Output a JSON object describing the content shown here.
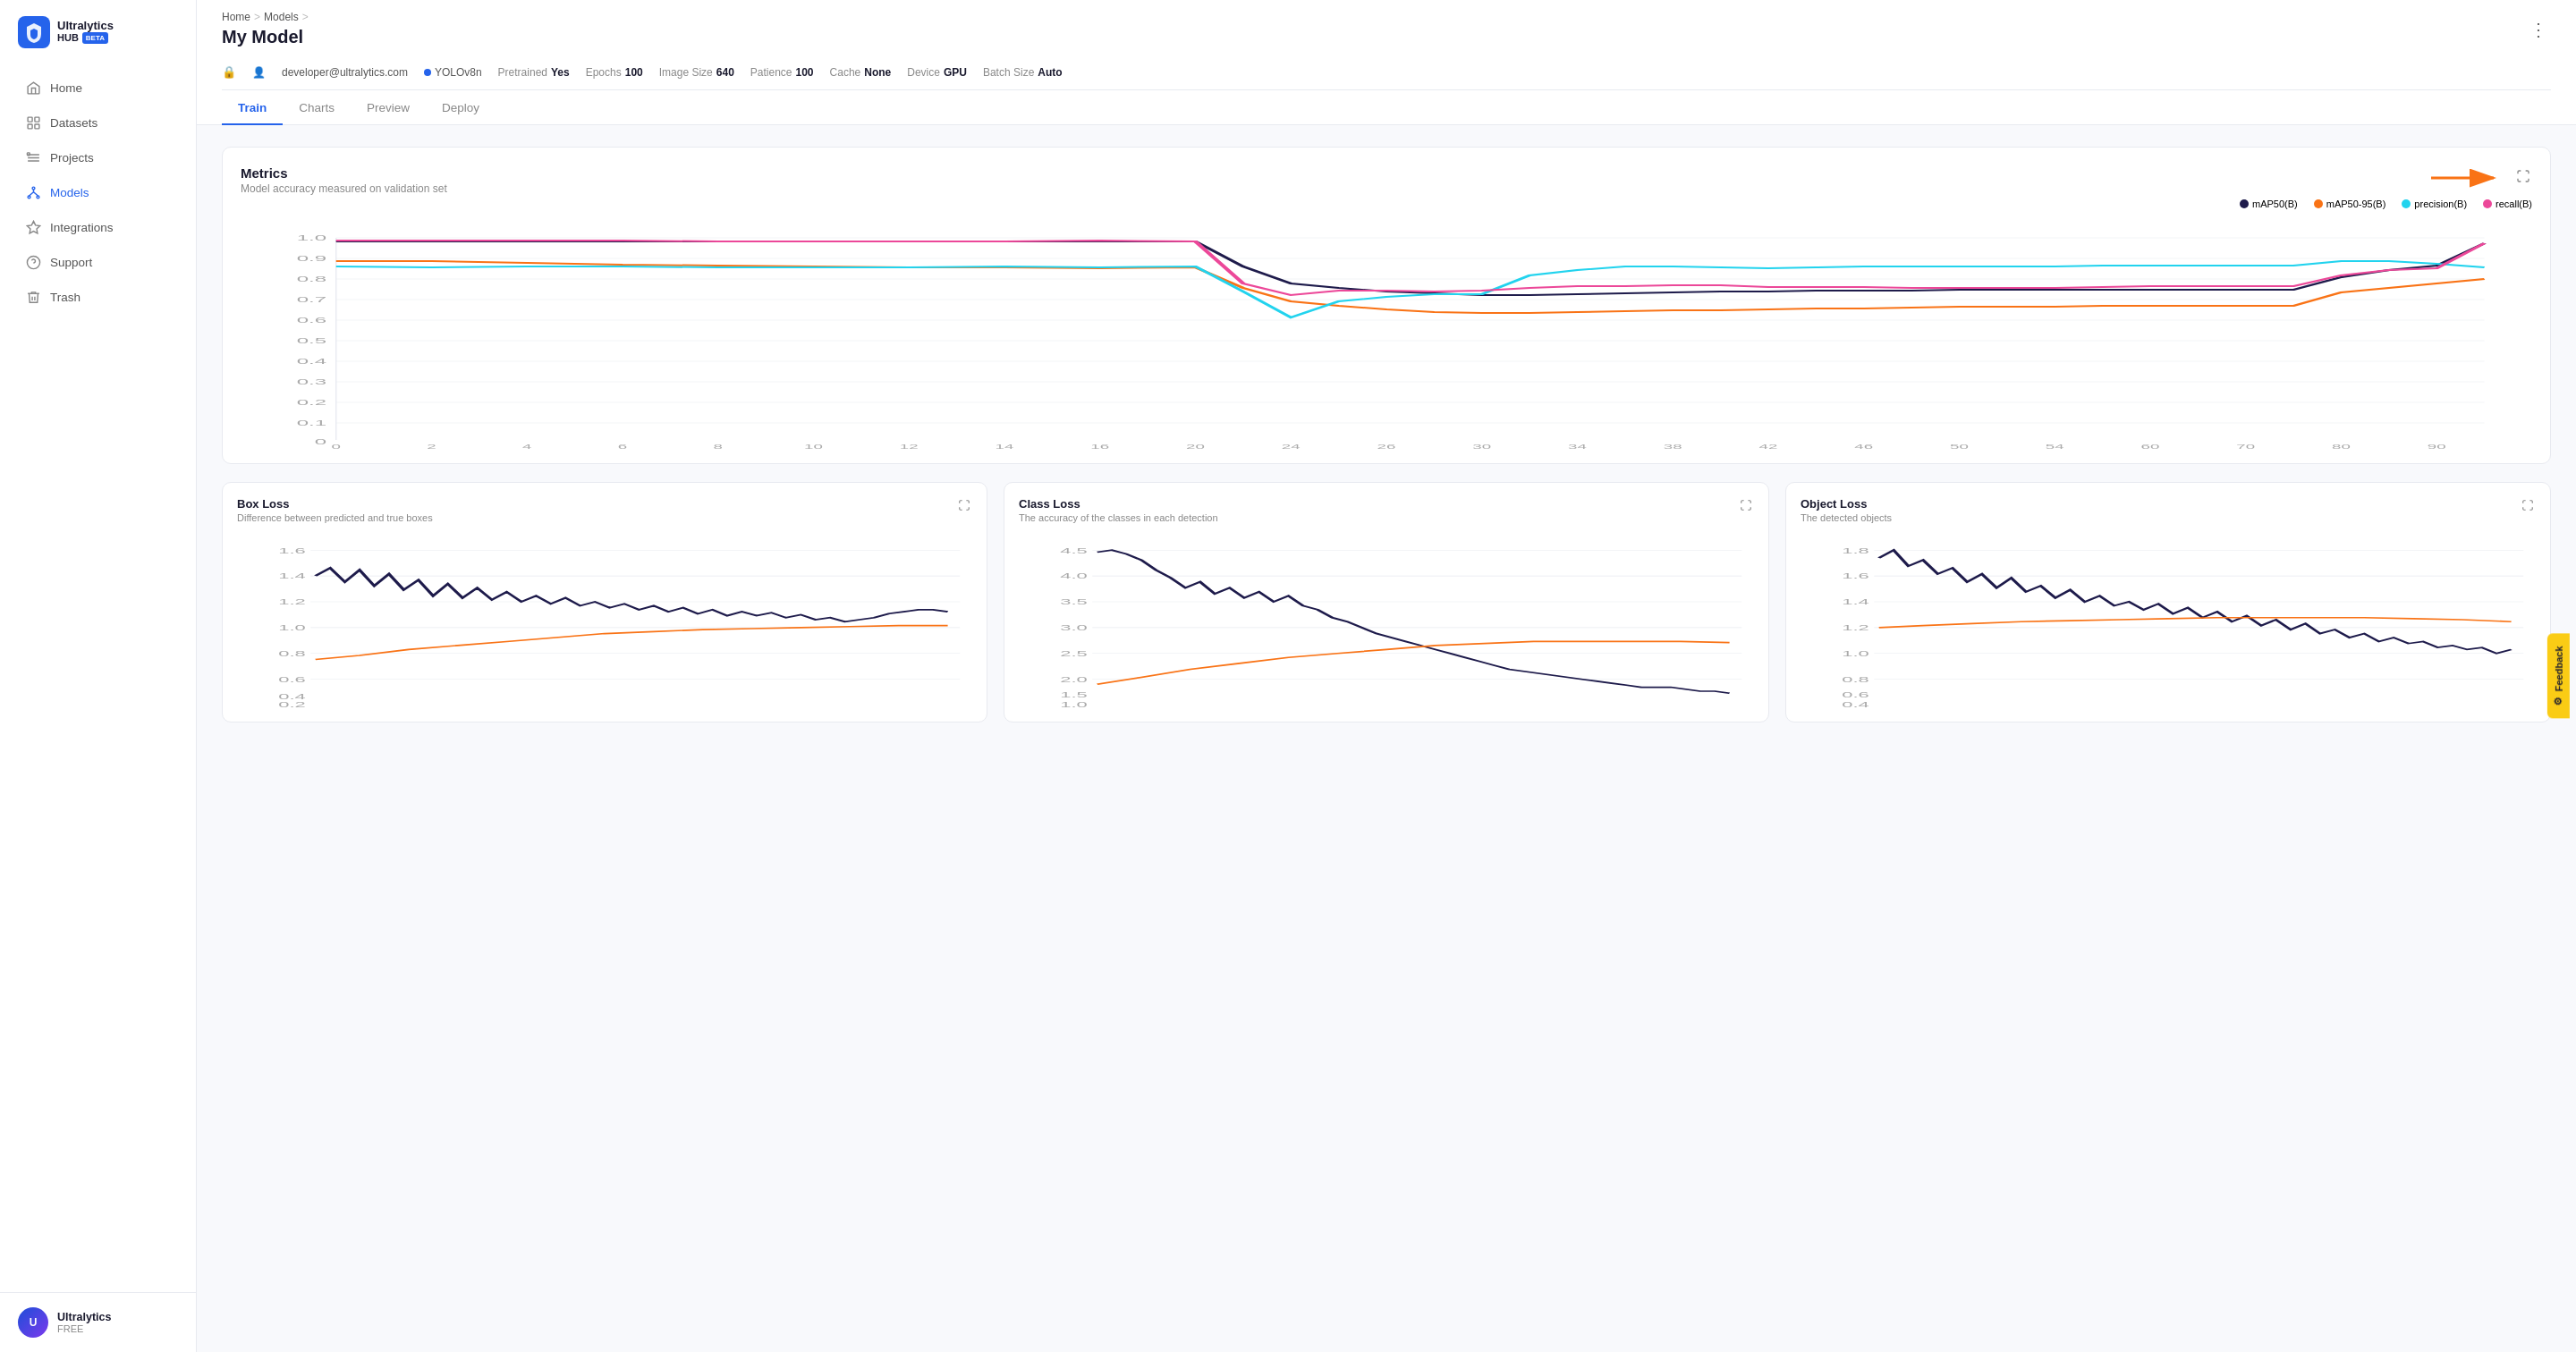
{
  "sidebar": {
    "logo": {
      "name": "Ultralytics",
      "hub": "HUB",
      "beta": "BETA"
    },
    "items": [
      {
        "id": "home",
        "label": "Home",
        "icon": "home"
      },
      {
        "id": "datasets",
        "label": "Datasets",
        "icon": "datasets"
      },
      {
        "id": "projects",
        "label": "Projects",
        "icon": "projects"
      },
      {
        "id": "models",
        "label": "Models",
        "icon": "models",
        "active": true
      },
      {
        "id": "integrations",
        "label": "Integrations",
        "icon": "integrations"
      },
      {
        "id": "support",
        "label": "Support",
        "icon": "support"
      },
      {
        "id": "trash",
        "label": "Trash",
        "icon": "trash"
      }
    ],
    "user": {
      "name": "Ultralytics",
      "plan": "FREE"
    }
  },
  "header": {
    "breadcrumb": [
      "Home",
      "Models"
    ],
    "title": "My Model",
    "model_info": {
      "email": "developer@ultralytics.com",
      "model": "YOLOv8n",
      "pretrained_label": "Pretrained",
      "pretrained_value": "Yes",
      "epochs_label": "Epochs",
      "epochs_value": "100",
      "image_size_label": "Image Size",
      "image_size_value": "640",
      "patience_label": "Patience",
      "patience_value": "100",
      "cache_label": "Cache",
      "cache_value": "None",
      "device_label": "Device",
      "device_value": "GPU",
      "batch_size_label": "Batch Size",
      "batch_size_value": "Auto"
    },
    "tabs": [
      {
        "id": "train",
        "label": "Train",
        "active": true
      },
      {
        "id": "charts",
        "label": "Charts",
        "active": false
      },
      {
        "id": "preview",
        "label": "Preview",
        "active": false
      },
      {
        "id": "deploy",
        "label": "Deploy",
        "active": false
      }
    ]
  },
  "metrics_chart": {
    "title": "Metrics",
    "subtitle": "Model accuracy measured on validation set",
    "legend": [
      {
        "label": "mAP50(B)",
        "color": "#1e1b4b"
      },
      {
        "label": "mAP50-95(B)",
        "color": "#f97316"
      },
      {
        "label": "precision(B)",
        "color": "#22d3ee"
      },
      {
        "label": "recall(B)",
        "color": "#ec4899"
      }
    ],
    "y_axis": [
      "1.0",
      "0.9",
      "0.8",
      "0.7",
      "0.6",
      "0.5",
      "0.4",
      "0.3",
      "0.2",
      "0.1",
      "0"
    ]
  },
  "bottom_charts": [
    {
      "id": "box_loss",
      "title": "Box Loss",
      "subtitle": "Difference between predicted and true boxes",
      "y_max": "1.6",
      "y_min": "0.2"
    },
    {
      "id": "class_loss",
      "title": "Class Loss",
      "subtitle": "The accuracy of the classes in each detection",
      "y_max": "4.5",
      "y_min": "0.5"
    },
    {
      "id": "object_loss",
      "title": "Object Loss",
      "subtitle": "The detected objects",
      "y_max": "1.8",
      "y_min": "0.2"
    }
  ],
  "feedback": {
    "label": "Feedback"
  }
}
